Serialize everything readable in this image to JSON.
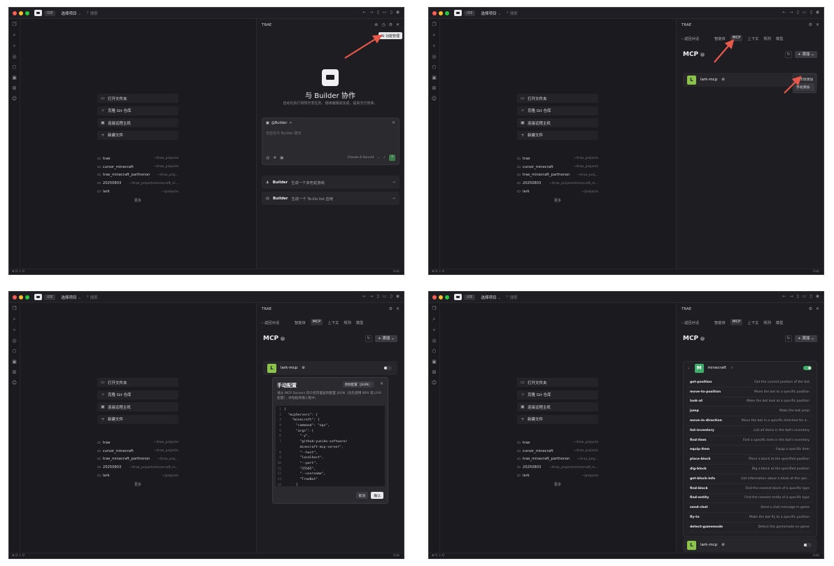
{
  "titlebar": {
    "ide": "IDE",
    "project": "选择项目",
    "search": "搜索"
  },
  "welcome": {
    "actions": [
      "打开文件夹",
      "克隆 Git 仓库",
      "连接远程主机",
      "新建文件"
    ],
    "recent": [
      {
        "name": "trae",
        "path": "~/trae_projects"
      },
      {
        "name": "cursor_minecraft",
        "path": "~/trae_projects"
      },
      {
        "name": "trae_minecraft_parthenon",
        "path": "~/trae_proj..."
      },
      {
        "name": "20250803",
        "path": "~/trae_projects/minecraft_m..."
      },
      {
        "name": "lark",
        "path": "~/projects"
      }
    ],
    "more": "更多"
  },
  "status": {
    "left": "⊗ 0 ⚠ 0",
    "right": "Gab"
  },
  "ai": {
    "title": "TRAE",
    "tooltip": "AI 功能管理",
    "heading": "与 Builder 协作",
    "subheading": "自动化执行常规开发任务、继续编辑其完成、提高交付效率。",
    "chat_tag": "@Builder",
    "chat_placeholder": "也还在与 Builder 聊天",
    "model": "Claude-4-Sonnet",
    "suggestions": [
      {
        "bold": "Builder",
        "text": "生成一个贪吃蛇游戏"
      },
      {
        "bold": "Builder",
        "text": "生成一个 To-Do list 应用"
      }
    ]
  },
  "mcp": {
    "title": "TRAE",
    "back": "返回对话",
    "tabs": [
      "智能体",
      "MCP",
      "上下文",
      "规则",
      "模型"
    ],
    "heading": "MCP",
    "add": "+ 添加",
    "dropdown": [
      "从市场添加",
      "手动添加"
    ],
    "lark": "lark-mcp",
    "minecraft": "minecraft"
  },
  "modal": {
    "title": "手动配置",
    "raw": "原始配置（JSON）",
    "desc": "请从 MCP Servers 的介绍页面复制配置 JSON（优先使用 NPX 或 UVX 配置），并粘贴到输入框中。",
    "cancel": "取消",
    "confirm": "确认",
    "code": [
      "{",
      "  \"mcpServers\": {",
      "    \"minecraft\": {",
      "      \"command\": \"npx\",",
      "      \"args\": [",
      "        \"-y\",",
      "        \"github:yuniko-software/",
      "        minecraft-mcp-server\",",
      "        \"--host\",",
      "        \"localhost\",",
      "        \"--port\",",
      "        \"25565\",",
      "        \"--username\",",
      "        \"TraeBot\"",
      "      ]"
    ],
    "line_numbers": [
      "1",
      "2",
      "3",
      "4",
      "5",
      "6",
      "7",
      "",
      "8",
      "9",
      "10",
      "11",
      "12",
      "13",
      "14"
    ]
  },
  "tools": [
    {
      "name": "get-position",
      "desc": "Get the current position of the bot"
    },
    {
      "name": "move-to-position",
      "desc": "Move the bot to a specific position"
    },
    {
      "name": "look-at",
      "desc": "Make the bot look at a specific position"
    },
    {
      "name": "jump",
      "desc": "Make the bot jump"
    },
    {
      "name": "move-in-direction",
      "desc": "Move the bot in a specific direction for a..."
    },
    {
      "name": "list-inventory",
      "desc": "List all items in the bot's inventory"
    },
    {
      "name": "find-item",
      "desc": "Find a specific item in the bot's inventory"
    },
    {
      "name": "equip-item",
      "desc": "Equip a specific item"
    },
    {
      "name": "place-block",
      "desc": "Place a block at the specified position"
    },
    {
      "name": "dig-block",
      "desc": "Dig a block at the specified position"
    },
    {
      "name": "get-block-info",
      "desc": "Get information about a block at the spe..."
    },
    {
      "name": "find-block",
      "desc": "Find the nearest block of a specific type"
    },
    {
      "name": "find-entity",
      "desc": "Find the nearest entity of a specific type"
    },
    {
      "name": "send-chat",
      "desc": "Send a chat message in-game"
    },
    {
      "name": "fly-to",
      "desc": "Make the bot fly to a specific position"
    },
    {
      "name": "detect-gamemode",
      "desc": "Detect the gamemode on game"
    }
  ],
  "colors": {
    "accent": "#3fae6a",
    "lark": "#8bc34a",
    "arrow": "#e8584a"
  }
}
